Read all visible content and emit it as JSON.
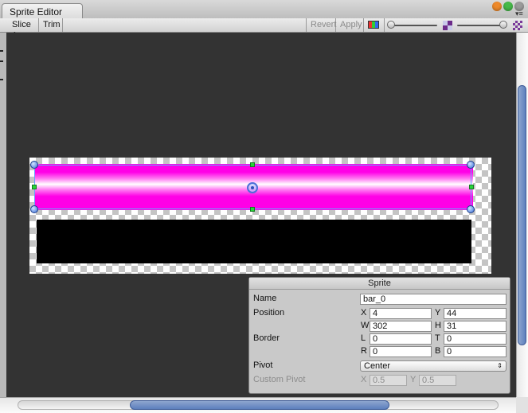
{
  "window": {
    "tab_title": "Sprite Editor",
    "traffic_colors": [
      "#ee8a2b",
      "#46b949",
      "#9b9b9b"
    ],
    "menu_icon": "dropdown-menu-icon"
  },
  "toolbar": {
    "slice_label": "Slice",
    "slice_arrow": "⇕",
    "trim_label": "Trim",
    "revert_label": "Revert",
    "apply_label": "Apply",
    "color_mode_icon": "rgb-channel-icon",
    "alpha_icon": "alpha-checker-icon",
    "mip_icon": "mip-checker-icon"
  },
  "canvas": {
    "background": "#333333",
    "sprite_colors": {
      "bar_top": "#ff00e6",
      "bar_bottom": "#000000"
    }
  },
  "inspector": {
    "title": "Sprite",
    "name_label": "Name",
    "name_value": "bar_0",
    "position_label": "Position",
    "x_label": "X",
    "x_value": "4",
    "y_label": "Y",
    "y_value": "44",
    "w_label": "W",
    "w_value": "302",
    "h_label": "H",
    "h_value": "31",
    "border_label": "Border",
    "l_label": "L",
    "l_value": "0",
    "t_label": "T",
    "t_value": "0",
    "r_label": "R",
    "r_value": "0",
    "b_label": "B",
    "b_value": "0",
    "pivot_label": "Pivot",
    "pivot_value": "Center",
    "pivot_arrow": "⇕",
    "custom_pivot_label": "Custom Pivot",
    "cp_x_label": "X",
    "cp_x_value": "0.5",
    "cp_y_label": "Y",
    "cp_y_value": "0.5"
  }
}
